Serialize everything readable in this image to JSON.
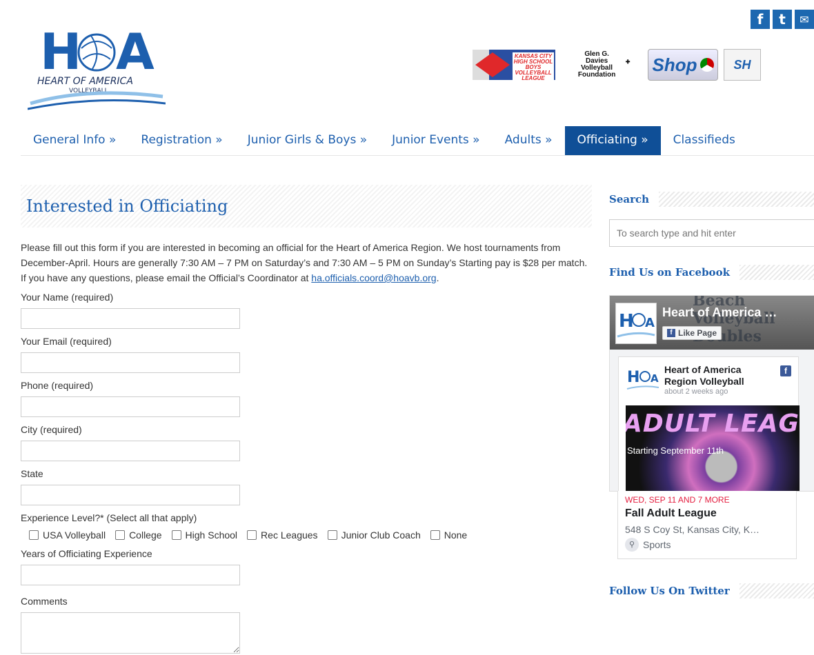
{
  "header": {
    "logo_text": "HOA",
    "logo_tagline": "HEART OF AMERICA",
    "logo_subline": "VOLLEYBALL",
    "social": [
      {
        "label": "f",
        "icon": "facebook-icon"
      },
      {
        "label": "t",
        "icon": "twitter-icon"
      },
      {
        "label": "✉",
        "icon": "email-icon"
      }
    ],
    "sponsors": {
      "kc": "KANSAS CITY HIGH SCHOOL BOYS VOLLEYBALL LEAGUE",
      "glen": "Glen G. Davies Volleyball Foundation",
      "shop": "Shop",
      "sh": "SH"
    }
  },
  "nav": [
    {
      "label": "General Info »",
      "active": false
    },
    {
      "label": "Registration »",
      "active": false
    },
    {
      "label": "Junior Girls & Boys »",
      "active": false
    },
    {
      "label": "Junior Events »",
      "active": false
    },
    {
      "label": "Adults »",
      "active": false
    },
    {
      "label": "Officiating »",
      "active": true
    },
    {
      "label": "Classifieds",
      "active": false
    }
  ],
  "main": {
    "title": "Interested in Officiating",
    "intro_1": "Please fill out this form if you are interested in becoming an official for the Heart of America Region. We host tournaments from December-April. Hours are generally 7:30 AM – 7 PM on Saturday’s and 7:30 AM – 5 PM on Sunday’s  Starting pay is $28 per match.",
    "intro_2_prefix": "If you have any questions, please email the Official’s Coordinator at ",
    "intro_2_email": "ha.officials.coord@hoavb.org",
    "intro_2_suffix": ".",
    "fields": {
      "name": "Your Name (required)",
      "email": "Your Email (required)",
      "phone": "Phone (required)",
      "city": "City (required)",
      "state": "State",
      "experience": "Experience Level?* (Select all that apply)",
      "years": "Years of Officiating Experience",
      "comments": "Comments"
    },
    "experience_options": [
      "USA Volleyball",
      "College",
      "High School",
      "Rec Leagues",
      "Junior Club Coach",
      "None"
    ]
  },
  "sidebar": {
    "search_title": "Search",
    "search_placeholder": "To search type and hit enter",
    "facebook_title": "Find Us on Facebook",
    "fb": {
      "cover_bg_text": "Beach Volleyball Doubles",
      "page_name": "Heart of America …",
      "like_label": "Like Page",
      "post_author": "Heart of America Region Volleyball",
      "post_time": "about 2 weeks ago",
      "image_title": "ADULT LEAGUE",
      "image_sub": "Starting September 11th",
      "event_date": "WED, SEP 11 AND 7 MORE",
      "event_name": "Fall Adult League",
      "event_address": "548 S Coy St, Kansas City, K…",
      "event_category": "Sports"
    },
    "twitter_title": "Follow Us On Twitter"
  }
}
